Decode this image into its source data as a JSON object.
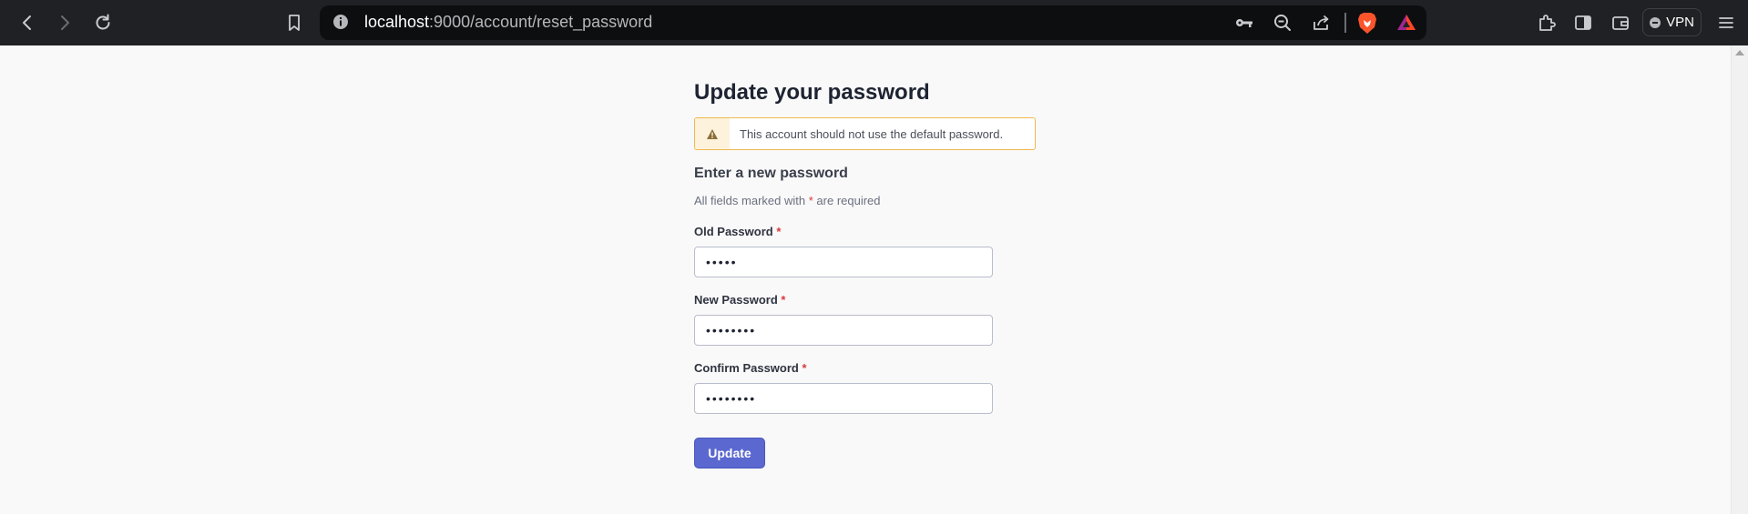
{
  "browser": {
    "url_host": "localhost",
    "url_path": ":9000/account/reset_password",
    "vpn_label": "VPN",
    "icons": [
      "back-icon",
      "forward-icon",
      "reload-icon",
      "bookmark-icon",
      "site-info-icon",
      "key-icon",
      "zoom-icon",
      "share-icon",
      "brave-shield-icon",
      "brave-rewards-icon",
      "extensions-icon",
      "sidebar-icon",
      "wallet-icon",
      "menu-icon"
    ]
  },
  "page": {
    "title": "Update your password",
    "alert": {
      "icon": "warning-icon",
      "text": "This account should not use the default password.",
      "border_color": "#f0b950",
      "icon_color": "#8a6d3b"
    },
    "section_title": "Enter a new password",
    "required_note": {
      "before": "All fields marked with",
      "star": "*",
      "after": "are required"
    },
    "fields": [
      {
        "label": "Old Password",
        "required": "*",
        "value": "•••••"
      },
      {
        "label": "New Password",
        "required": "*",
        "value": "••••••••"
      },
      {
        "label": "Confirm Password",
        "required": "*",
        "value": "••••••••"
      }
    ],
    "submit_label": "Update",
    "accent_color": "#5b68cf",
    "required_color": "#d93a3a"
  }
}
